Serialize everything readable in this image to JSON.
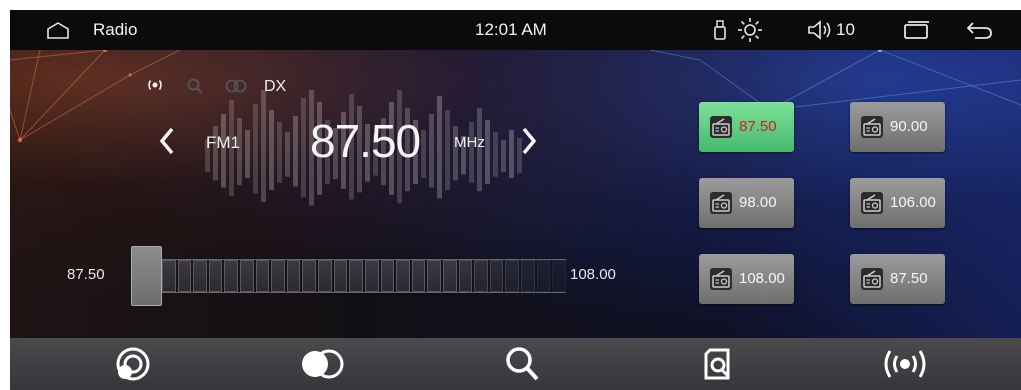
{
  "statusbar": {
    "title": "Radio",
    "clock": "12:01 AM",
    "volume": "10",
    "icons": [
      "home-icon",
      "usb-icon",
      "brightness-icon",
      "volume-icon",
      "recent-apps-icon",
      "back-icon"
    ]
  },
  "tuner": {
    "indicators": {
      "dx_label": "DX",
      "icons": [
        "signal-icon",
        "search-icon",
        "stereo-icon"
      ]
    },
    "band": "FM1",
    "frequency": "87.50",
    "unit": "MHz",
    "scale_min": "87.50",
    "scale_max": "108.00",
    "tuning_position": 0
  },
  "presets": [
    {
      "label": "87.50",
      "active": true
    },
    {
      "label": "90.00",
      "active": false
    },
    {
      "label": "98.00",
      "active": false
    },
    {
      "label": "106.00",
      "active": false
    },
    {
      "label": "108.00",
      "active": false
    },
    {
      "label": "87.50",
      "active": false
    }
  ],
  "toolbar": {
    "icons": [
      "browse-stations-icon",
      "stereo-mode-icon",
      "search-icon",
      "local-scan-icon",
      "broadcast-icon"
    ]
  },
  "colors": {
    "active_preset_bg": "#5fcf80",
    "active_preset_text": "#d11f1f",
    "preset_bg": "#858585",
    "toolbar_bg": "#404044"
  }
}
